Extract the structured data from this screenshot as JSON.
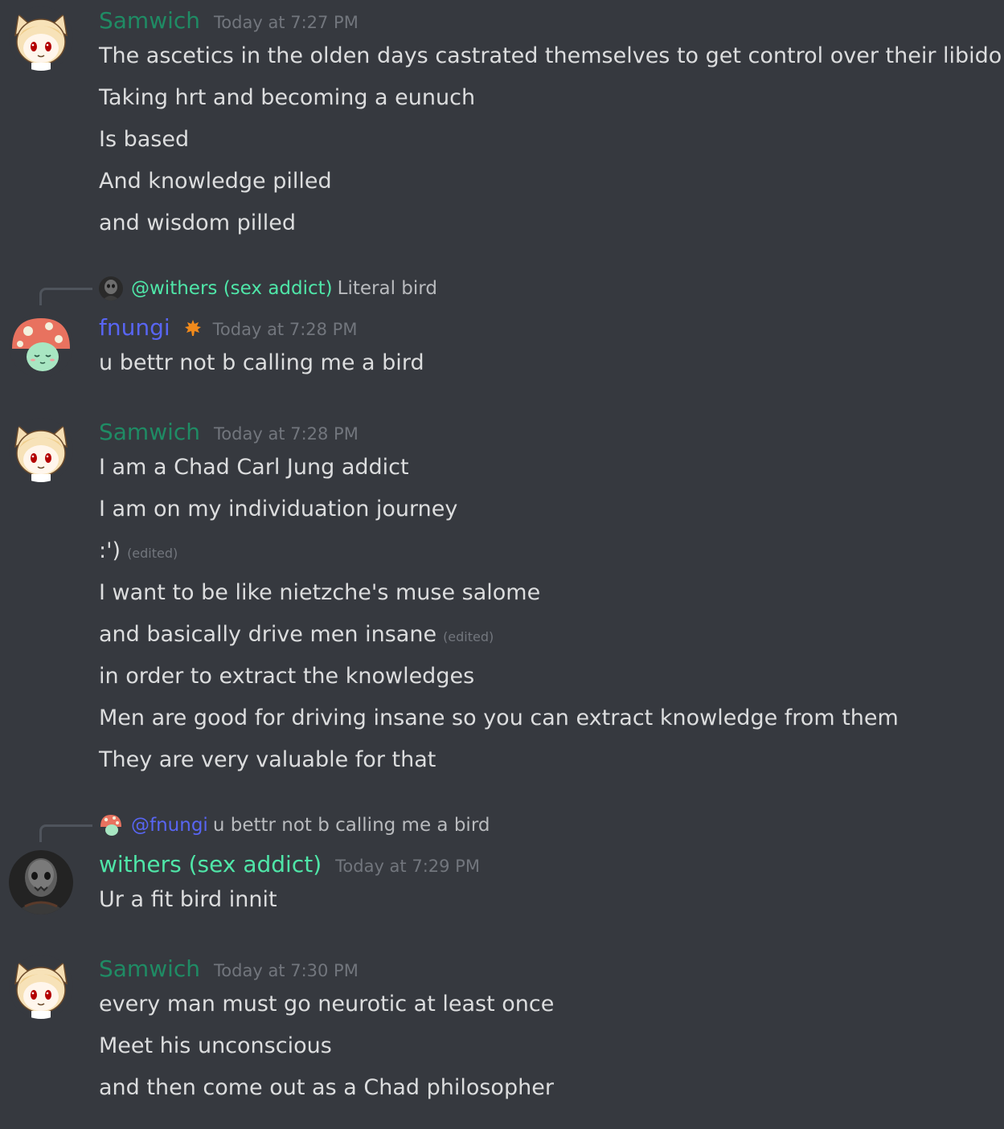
{
  "colors": {
    "background": "#36393f",
    "samwich": "#1f8b64",
    "fnungi": "#5865f2",
    "withers": "#4fe6a8",
    "timestamp": "#72767d",
    "text": "#dcddde"
  },
  "groups": [
    {
      "username": "Samwich",
      "timestamp": "Today at 7:27 PM",
      "avatar": "neko-arc-avatar",
      "lines": [
        {
          "text": "The ascetics in the olden days castrated themselves to get control over their libido"
        },
        {
          "text": "Taking hrt and becoming a eunuch"
        },
        {
          "text": "Is based"
        },
        {
          "text": "And knowledge pilled"
        },
        {
          "text": "and wisdom pilled"
        }
      ]
    },
    {
      "reply": {
        "mention": "@withers (sex addict)",
        "text": "Literal bird"
      },
      "username": "fnungi",
      "role_icon": "maple-leaf-icon",
      "timestamp": "Today at 7:28 PM",
      "avatar": "mushroom-avatar",
      "lines": [
        {
          "text": "u bettr not b calling me a bird"
        }
      ]
    },
    {
      "username": "Samwich",
      "timestamp": "Today at 7:28 PM",
      "avatar": "neko-arc-avatar",
      "lines": [
        {
          "text": "I am a Chad Carl Jung addict"
        },
        {
          "text": "I am on my individuation journey"
        },
        {
          "text": ":')",
          "edited": "(edited)"
        },
        {
          "text": "I want to be like nietzche's muse salome"
        },
        {
          "text": "and basically drive men insane",
          "edited": "(edited)"
        },
        {
          "text": "in order to extract the knowledges"
        },
        {
          "text": "Men are good for driving insane so you can extract knowledge from them"
        },
        {
          "text": "They are very valuable for that"
        }
      ]
    },
    {
      "reply": {
        "mention": "@fnungi",
        "text": "u bettr not b calling me a bird"
      },
      "username": "withers (sex addict)",
      "timestamp": "Today at 7:29 PM",
      "avatar": "dark-figure-avatar",
      "lines": [
        {
          "text": "Ur a fit bird innit"
        }
      ]
    },
    {
      "username": "Samwich",
      "timestamp": "Today at 7:30 PM",
      "avatar": "neko-arc-avatar",
      "lines": [
        {
          "text": "every man must go neurotic at least once"
        },
        {
          "text": "Meet his unconscious"
        },
        {
          "text": "and then come out as a Chad philosopher"
        }
      ]
    }
  ]
}
